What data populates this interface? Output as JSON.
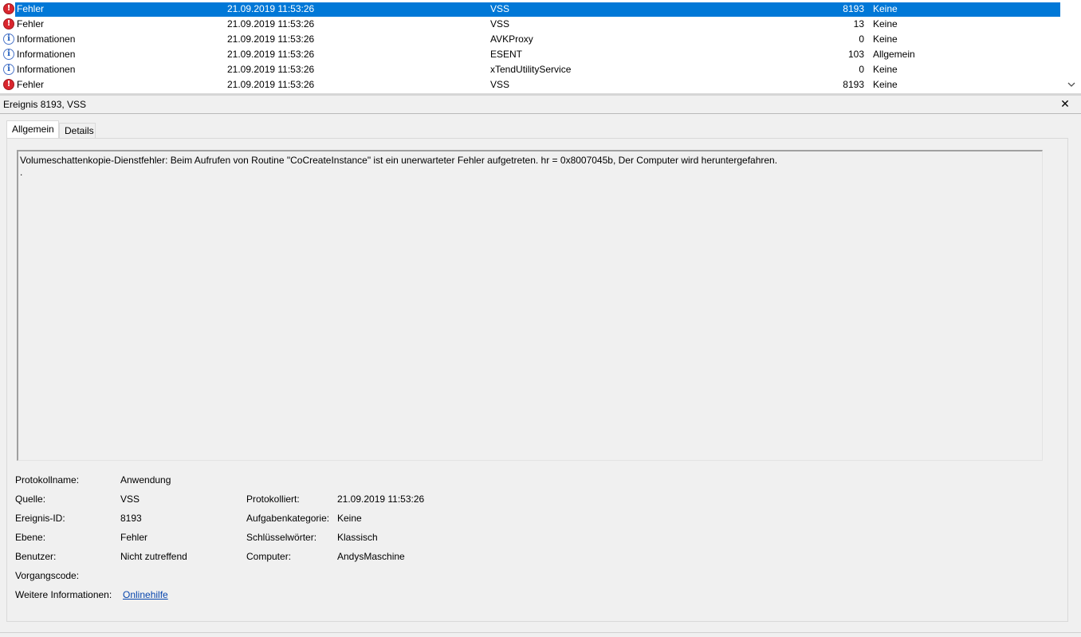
{
  "events": [
    {
      "level": "Fehler",
      "icon": "error-icon",
      "date": "21.09.2019 11:53:26",
      "source": "VSS",
      "id": "8193",
      "category": "Keine",
      "selected": true
    },
    {
      "level": "Fehler",
      "icon": "error-icon",
      "date": "21.09.2019 11:53:26",
      "source": "VSS",
      "id": "13",
      "category": "Keine",
      "selected": false
    },
    {
      "level": "Informationen",
      "icon": "info-icon",
      "date": "21.09.2019 11:53:26",
      "source": "AVKProxy",
      "id": "0",
      "category": "Keine",
      "selected": false
    },
    {
      "level": "Informationen",
      "icon": "info-icon",
      "date": "21.09.2019 11:53:26",
      "source": "ESENT",
      "id": "103",
      "category": "Allgemein",
      "selected": false
    },
    {
      "level": "Informationen",
      "icon": "info-icon",
      "date": "21.09.2019 11:53:26",
      "source": "xTendUtilityService",
      "id": "0",
      "category": "Keine",
      "selected": false
    },
    {
      "level": "Fehler",
      "icon": "error-icon",
      "date": "21.09.2019 11:53:26",
      "source": "VSS",
      "id": "8193",
      "category": "Keine",
      "selected": false
    }
  ],
  "detail": {
    "title": "Ereignis 8193, VSS",
    "close_glyph": "✕",
    "tabs": [
      "Allgemein",
      "Details"
    ],
    "message": "Volumeschattenkopie-Dienstfehler: Beim Aufrufen von Routine \"CoCreateInstance\" ist ein unerwarteter Fehler aufgetreten. hr = 0x8007045b, Der Computer wird heruntergefahren.\n.",
    "labels": {
      "log_name": "Protokollname:",
      "source": "Quelle:",
      "event_id": "Ereignis-ID:",
      "level": "Ebene:",
      "user": "Benutzer:",
      "opcode": "Vorgangscode:",
      "more_info": "Weitere Informationen:",
      "logged": "Protokolliert:",
      "task_category": "Aufgabenkategorie:",
      "keywords": "Schlüsselwörter:",
      "computer": "Computer:"
    },
    "values": {
      "log_name": "Anwendung",
      "source": "VSS",
      "event_id": "8193",
      "level": "Fehler",
      "user": "Nicht zutreffend",
      "opcode": "",
      "more_info_link": "Onlinehilfe",
      "logged": "21.09.2019 11:53:26",
      "task_category": "Keine",
      "keywords": "Klassisch",
      "computer": "AndysMaschine"
    }
  },
  "colors": {
    "selection": "#0078d7",
    "error_icon": "#d9262e",
    "info_icon": "#1e5bbd",
    "link": "#0645ad"
  }
}
